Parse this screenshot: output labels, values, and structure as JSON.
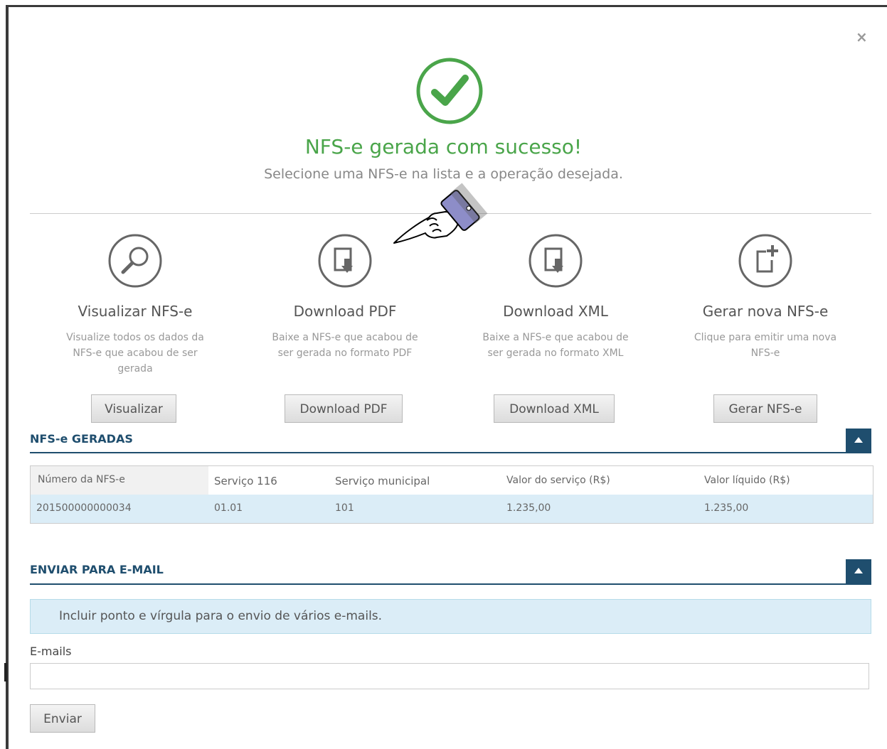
{
  "modal": {
    "close_icon": "×",
    "title": "NFS-e gerada com sucesso!",
    "subtitle": "Selecione uma NFS-e na lista e a operação desejada."
  },
  "actions": [
    {
      "icon": "search-icon",
      "title": "Visualizar NFS-e",
      "desc": "Visualize todos os dados da NFS-e que acabou de ser gerada",
      "button": "Visualizar"
    },
    {
      "icon": "download-pdf-icon",
      "title": "Download PDF",
      "desc": "Baixe a NFS-e que acabou de ser gerada no formato PDF",
      "button": "Download PDF"
    },
    {
      "icon": "download-xml-icon",
      "title": "Download XML",
      "desc": "Baixe a NFS-e que acabou de ser gerada no formato XML",
      "button": "Download XML"
    },
    {
      "icon": "new-document-icon",
      "title": "Gerar nova NFS-e",
      "desc": "Clique para emitir uma nova NFS-e",
      "button": "Gerar NFS-e"
    }
  ],
  "generated": {
    "title": "NFS-e GERADAS",
    "columns": [
      "Número da NFS-e",
      "Serviço 116",
      "Serviço municipal",
      "Valor do serviço (R$)",
      "Valor líquido (R$)"
    ],
    "rows": [
      [
        "201500000000034",
        "01.01",
        "101",
        "1.235,00",
        "1.235,00"
      ]
    ]
  },
  "email": {
    "title": "ENVIAR PARA E-MAIL",
    "info": "Incluir ponto e vírgula para o envio de vários e-mails.",
    "label": "E-mails",
    "value": "",
    "send": "Enviar"
  },
  "colors": {
    "success": "#4aa54a",
    "section": "#1f4e6e",
    "row_highlight": "#dbedf7"
  }
}
